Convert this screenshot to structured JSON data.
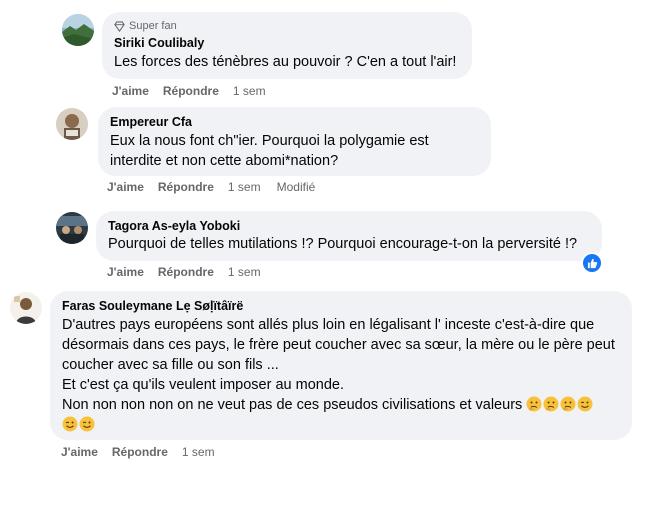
{
  "comments": [
    {
      "badge": "Super fan",
      "author": "Siriki Coulibaly",
      "lines": [
        "Les forces des ténèbres au pouvoir ? C'en a tout l'air!"
      ],
      "like": "J'aime",
      "reply": "Répondre",
      "time": "1 sem"
    },
    {
      "author": "Empereur Cfa",
      "lines": [
        "Eux la nous font ch\"ier. Pourquoi la polygamie est",
        "interdite et non cette abomi*nation?"
      ],
      "like": "J'aime",
      "reply": "Répondre",
      "time": "1 sem",
      "edited": "Modifié"
    },
    {
      "author": "Tagora As-eyla Yoboki",
      "lines": [
        "Pourquoi de telles mutilations !? Pourquoi encourage-t-on la perversité !?"
      ],
      "like": "J'aime",
      "reply": "Répondre",
      "time": "1 sem",
      "reaction": "like-icon"
    },
    {
      "author": "Faras Souleymane Lẹ Søḷïtâïrë",
      "lines": [
        "D'autres pays européens sont allés plus loin en légalisant l' inceste c'est-à-dire que",
        "désormais dans ces pays, le frère peut coucher avec sa sœur, la mère ou le père peut",
        "coucher avec sa fille ou son fils ...",
        "Et c'est ça qu'ils veulent imposer au monde.",
        "Non non non non on ne veut pas de ces pseudos civilisations et valeurs"
      ],
      "emojis": [
        "thinking-face-icon",
        "thinking-face-icon",
        "thinking-face-icon",
        "winking-face-icon",
        "winking-face-icon",
        "winking-face-icon"
      ],
      "like": "J'aime",
      "reply": "Répondre",
      "time": "1 sem"
    }
  ],
  "colors": {
    "bubble": "#f0f2f5",
    "meta": "#65676b",
    "like_badge": "#1877f2"
  }
}
